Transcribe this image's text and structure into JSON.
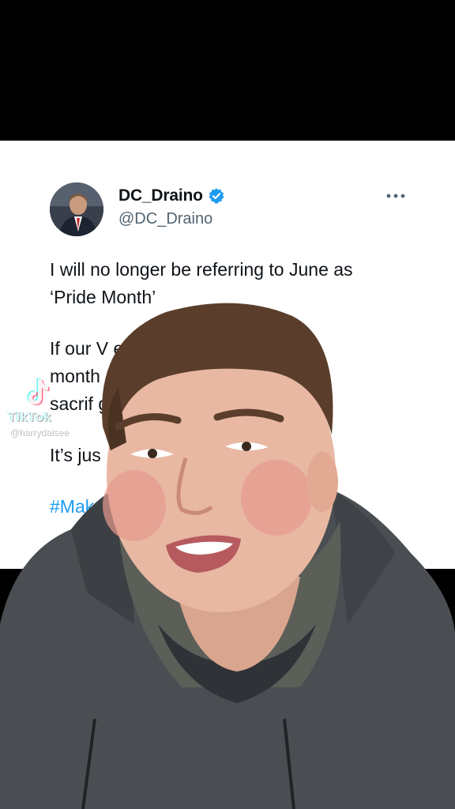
{
  "tweet": {
    "author_name": "DC_Draino",
    "author_handle": "@DC_Draino",
    "paragraphs": [
      "I will no longer be referring to June as\n‘Pride Month’",
      "If our V                              entire\nmonth                                         ,\nsacrif                                     get one",
      "It’s jus"
    ],
    "hashtag": "#Mak",
    "colors": {
      "text": "#0f1419",
      "secondary": "#536471",
      "accent": "#1d9bf0",
      "verified": "#1d9bf0"
    },
    "icons": {
      "verified": "verified-badge-icon",
      "more": "more-options-icon"
    }
  },
  "watermark": {
    "brand": "TikTok",
    "username": "@harrydaisee"
  }
}
